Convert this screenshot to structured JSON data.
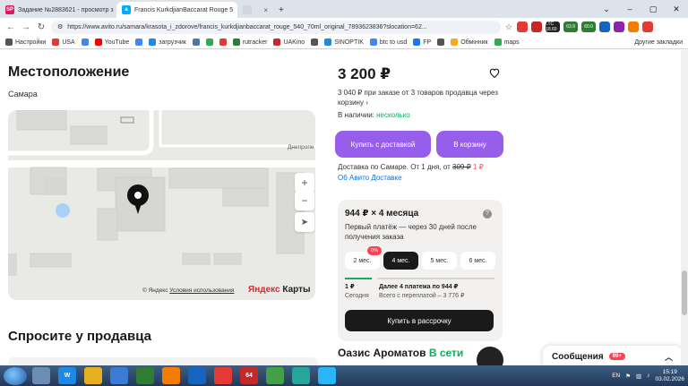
{
  "browser": {
    "tabs": [
      {
        "label": "Задание №2883621 - просмотр з",
        "icon": "sp-favicon",
        "active": false
      },
      {
        "label": "Francis KurkdjianBaccarat Rouge 5",
        "icon": "avito-favicon",
        "active": true
      },
      {
        "label": "",
        "icon": "blank-favicon",
        "active": false
      }
    ],
    "url": "https://www.avito.ru/samara/krasota_i_zdorove/francis_kurkdjianbaccarat_rouge_540_70ml_original_7893623836?slocation=62...",
    "extensions": [
      {
        "label": "",
        "color": "#e53935"
      },
      {
        "label": "",
        "color": "#c62828"
      },
      {
        "label": "LTC 18.60",
        "color": "#222222"
      },
      {
        "label": "63.9",
        "color": "#2e7d32"
      },
      {
        "label": "60.0",
        "color": "#2e7d32"
      },
      {
        "label": "",
        "color": "#1565c0"
      },
      {
        "label": "",
        "color": "#8e24aa"
      },
      {
        "label": "",
        "color": "#f57c00"
      },
      {
        "label": "",
        "color": "#e53935"
      }
    ],
    "bookmarks": [
      {
        "label": "Настройки",
        "color": "#555555"
      },
      {
        "label": "USA",
        "color": "#e53935"
      },
      {
        "label": "",
        "color": "#4285f4"
      },
      {
        "label": "YouTube",
        "color": "#ff0000"
      },
      {
        "label": "",
        "color": "#4285f4"
      },
      {
        "label": "загрузчик",
        "color": "#1e88e5"
      },
      {
        "label": "",
        "color": "#4a76a8"
      },
      {
        "label": "",
        "color": "#34a853"
      },
      {
        "label": "",
        "color": "#e53935"
      },
      {
        "label": "rutracker",
        "color": "#2e7d32"
      },
      {
        "label": "UAKino",
        "color": "#c62828"
      },
      {
        "label": "",
        "color": "#555555"
      },
      {
        "label": "SINOPTIK",
        "color": "#1e88e5"
      },
      {
        "label": "btc to usd",
        "color": "#4285f4"
      },
      {
        "label": "FP",
        "color": "#1877f2"
      },
      {
        "label": "",
        "color": "#555555"
      },
      {
        "label": "Обмінник",
        "color": "#f9a825"
      },
      {
        "label": "maps",
        "color": "#34a853"
      }
    ],
    "other_bookmarks": "Другие закладки"
  },
  "listing": {
    "location_title": "Местоположение",
    "city": "Самара",
    "map_street": "Днепропе",
    "map_copyright": "© Яндекс",
    "map_terms": "Условия использования",
    "map_logo": "Яндекс",
    "map_logo_suffix": " Карты",
    "ask_seller": "Спросите у продавца",
    "price": "3 200 ₽",
    "promo_price": "3 040 ₽ при заказе от 3 товаров продавца через корзину",
    "stock_label": "В наличии:",
    "stock_value": "несколько",
    "buy_delivery": "Купить с доставкой",
    "to_cart": "В корзину",
    "delivery_prefix": "Доставка по Самаре. От 1 дня, от",
    "delivery_old": "309 ₽",
    "delivery_new": "1 ₽",
    "avito_delivery_link": "Об Авито Доставке",
    "installment": {
      "title": "944 ₽ × 4 месяца",
      "subtitle": "Первый платёж — через 30 дней после получения заказа",
      "badge": "0%",
      "options": [
        "2 мес.",
        "4 мес.",
        "5 мес.",
        "6 мес."
      ],
      "selected_index": 1,
      "today_amount": "1 ₽",
      "today_label": "Сегодня",
      "later_title": "Далее 4 платежа по 944 ₽",
      "later_total": "Всего с переплатой – 3 776 ₽",
      "button": "Купить в рассрочку"
    },
    "seller_name": "Оазис Ароматов",
    "seller_status": "В сети",
    "messages_label": "Сообщения",
    "messages_count": "99+"
  },
  "taskbar": {
    "apps": [
      {
        "label": "",
        "color": "#6d8cb3"
      },
      {
        "label": "W",
        "color": "#1e88e5"
      },
      {
        "label": "",
        "color": "#e8b020"
      },
      {
        "label": "",
        "color": "#3a7bd5"
      },
      {
        "label": "",
        "color": "#2e7d32"
      },
      {
        "label": "",
        "color": "#f57c00"
      },
      {
        "label": "",
        "color": "#1565c0"
      },
      {
        "label": "",
        "color": "#e53935"
      },
      {
        "label": "64",
        "color": "#c62828"
      },
      {
        "label": "",
        "color": "#43a047"
      },
      {
        "label": "",
        "color": "#26a69a"
      },
      {
        "label": "",
        "color": "#29b6f6"
      }
    ],
    "lang": "EN",
    "time": "15:19",
    "date": "03.02.2026"
  },
  "colors": {
    "accent": "#965eeb",
    "green": "#0fad5e",
    "link": "#0a74d6",
    "red": "#ff4053"
  }
}
